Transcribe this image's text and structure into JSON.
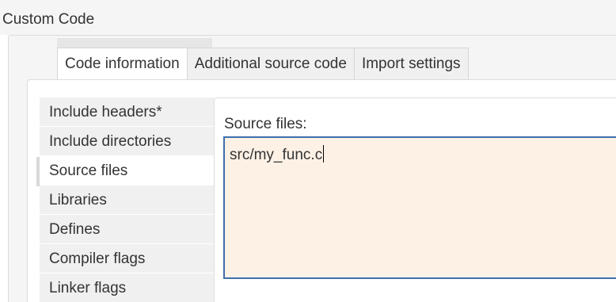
{
  "section": {
    "title": "Custom Code"
  },
  "tabs": [
    {
      "label": "Code information",
      "active": true
    },
    {
      "label": "Additional source code",
      "active": false
    },
    {
      "label": "Import settings",
      "active": false
    }
  ],
  "nav": {
    "items": [
      {
        "label": "Include headers*",
        "selected": false
      },
      {
        "label": "Include directories",
        "selected": false
      },
      {
        "label": "Source files",
        "selected": true
      },
      {
        "label": "Libraries",
        "selected": false
      },
      {
        "label": "Defines",
        "selected": false
      },
      {
        "label": "Compiler flags",
        "selected": false
      },
      {
        "label": "Linker flags",
        "selected": false
      }
    ]
  },
  "editor": {
    "label": "Source files:",
    "value": "src/my_func.c"
  },
  "colors": {
    "textarea_bg": "#fdf1e6",
    "focus_border": "#3f6fad",
    "panel_bg": "#f5f5f5",
    "inactive_bg": "#f0f0f0"
  }
}
